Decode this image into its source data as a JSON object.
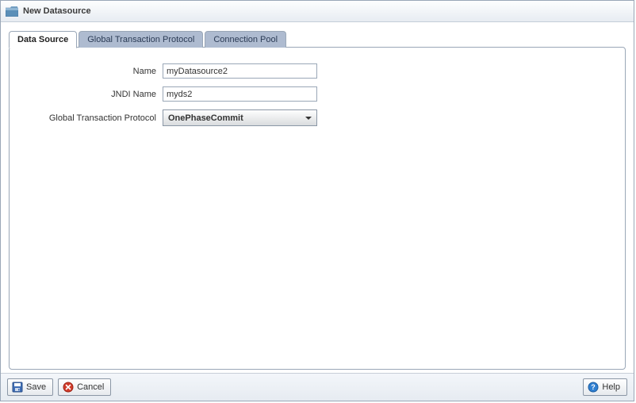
{
  "window": {
    "title": "New Datasource"
  },
  "tabs": {
    "data_source": "Data Source",
    "global_txn": "Global Transaction Protocol",
    "conn_pool": "Connection Pool"
  },
  "form": {
    "name_label": "Name",
    "name_value": "myDatasource2",
    "jndi_label": "JNDI Name",
    "jndi_value": "myds2",
    "gtp_label": "Global Transaction Protocol",
    "gtp_value": "OnePhaseCommit"
  },
  "buttons": {
    "save": "Save",
    "cancel": "Cancel",
    "help": "Help"
  }
}
